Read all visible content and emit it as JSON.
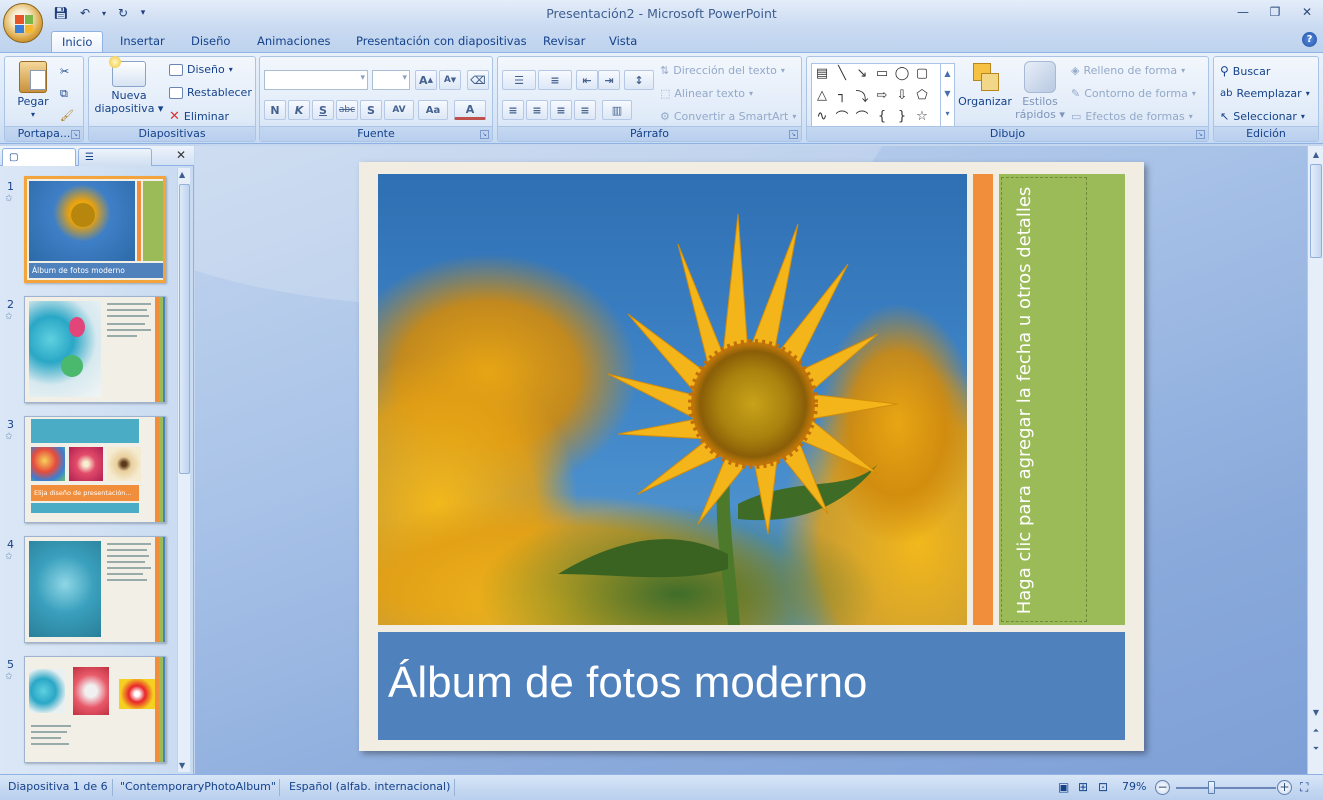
{
  "window": {
    "title": "Presentación2 - Microsoft PowerPoint"
  },
  "tabs": [
    "Inicio",
    "Insertar",
    "Diseño",
    "Animaciones",
    "Presentación con diapositivas",
    "Revisar",
    "Vista"
  ],
  "ribbon": {
    "portapapeles": {
      "label": "Portapa...",
      "pegar": "Pegar"
    },
    "diapositivas": {
      "label": "Diapositivas",
      "nueva": "Nueva",
      "nueva2": "diapositiva",
      "diseno": "Diseño",
      "restablecer": "Restablecer",
      "eliminar": "Eliminar"
    },
    "fuente": {
      "label": "Fuente",
      "bold": "N",
      "italic": "K",
      "underline": "S",
      "strike": "abc",
      "shadow": "S",
      "spacing": "AV",
      "case": "Aa",
      "color": "A",
      "grow": "A",
      "shrink": "A"
    },
    "parrafo": {
      "label": "Párrafo",
      "direccion": "Dirección del texto",
      "alinear": "Alinear texto",
      "smartart": "Convertir a SmartArt"
    },
    "dibujo": {
      "label": "Dibujo",
      "organizar": "Organizar",
      "estilos1": "Estilos",
      "estilos2": "rápidos",
      "relleno": "Relleno de forma",
      "contorno": "Contorno de forma",
      "efectos": "Efectos de formas"
    },
    "edicion": {
      "label": "Edición",
      "buscar": "Buscar",
      "reemplazar": "Reemplazar",
      "seleccionar": "Seleccionar"
    }
  },
  "thumbnails": [
    {
      "num": "1",
      "caption": "Álbum de fotos moderno"
    },
    {
      "num": "2"
    },
    {
      "num": "3",
      "caption": "Elija diseño de presentación..."
    },
    {
      "num": "4"
    },
    {
      "num": "5"
    }
  ],
  "slide": {
    "title": "Álbum de fotos moderno",
    "side_text": "Haga clic para agregar la fecha u otros detalles"
  },
  "status": {
    "slide_of": "Diapositiva 1 de 6",
    "theme": "\"ContemporaryPhotoAlbum\"",
    "language": "Español (alfab. internacional)",
    "zoom": "79%"
  },
  "colors": {
    "slide_blue": "#4f81bd",
    "slide_green": "#9bbb59",
    "slide_orange": "#f08e3c",
    "thumb_selected": "#f3a43c"
  }
}
